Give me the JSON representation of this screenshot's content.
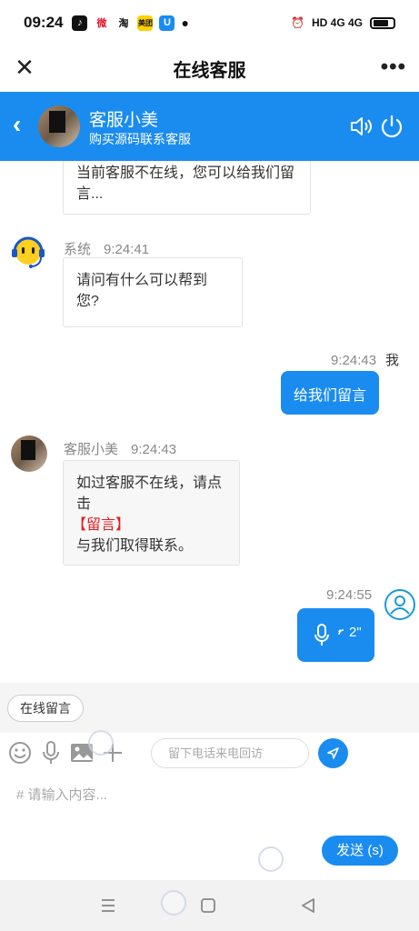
{
  "status_bar": {
    "time": "09:24",
    "apps": [
      "♪",
      "微",
      "淘",
      "美团",
      "U"
    ],
    "network": "HD 4G 4G"
  },
  "title_bar": {
    "title": "在线客服",
    "close_icon": "close-icon",
    "more_icon": "more-icon"
  },
  "chat_header": {
    "name": "客服小美",
    "subtitle": "购买源码联系客服"
  },
  "messages": [
    {
      "text": "当前客服不在线，您可以给我们留言..."
    },
    {
      "sender": "系统",
      "time": "9:24:41",
      "text": "请问有什么可以帮到您?"
    },
    {
      "sender": "我",
      "time": "9:24:43",
      "text": "给我们留言"
    },
    {
      "sender": "客服小美",
      "time": "9:24:43",
      "line1": "如过客服不在线，请点击",
      "highlight": "【留言】",
      "line2": "与我们取得联系。"
    },
    {
      "time": "9:24:55",
      "voice_duration": "2\""
    }
  ],
  "quick_reply": "在线留言",
  "toolbar": {
    "phone_placeholder": "留下电话来电回访"
  },
  "input": {
    "placeholder": "# 请输入内容...",
    "send_label": "发送 (s)"
  },
  "colors": {
    "accent": "#1a8cf0",
    "highlight": "#e02020"
  }
}
